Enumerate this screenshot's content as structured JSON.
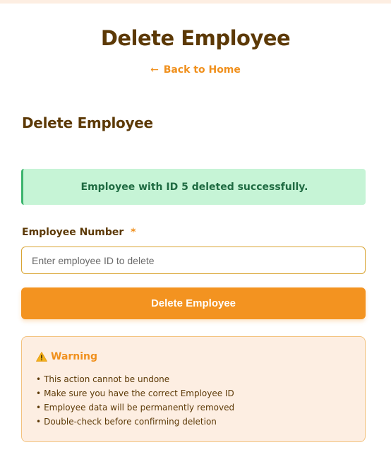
{
  "header": {
    "title": "Delete Employee",
    "back_link": "Back to Home",
    "back_arrow": "←"
  },
  "form": {
    "section_title": "Delete Employee",
    "success_message": "Employee with ID 5 deleted successfully.",
    "field_label": "Employee Number",
    "required_mark": "*",
    "input_value": "",
    "input_placeholder": "Enter employee ID to delete",
    "submit_label": "Delete Employee"
  },
  "warning": {
    "icon": "warning-triangle-icon",
    "title": "Warning",
    "items": [
      "This action cannot be undone",
      "Make sure you have the correct Employee ID",
      "Employee data will be permanently removed",
      "Double-check before confirming deletion"
    ]
  },
  "colors": {
    "title_text": "#5c3906",
    "accent_orange": "#f39320",
    "success_bg": "#c6f4d6",
    "success_border": "#3cb46e",
    "warning_bg": "#fdeee2",
    "warning_border": "#f3c27e"
  }
}
